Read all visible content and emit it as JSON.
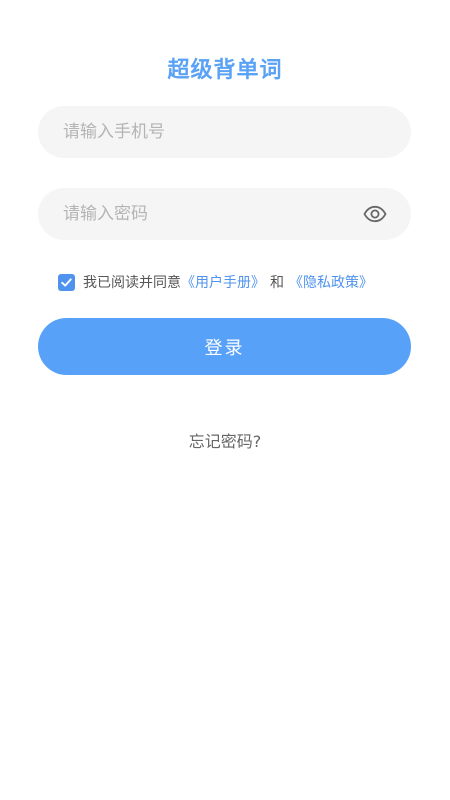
{
  "app": {
    "title": "超级背单词"
  },
  "form": {
    "phone_placeholder": "请输入手机号",
    "phone_value": "",
    "password_placeholder": "请输入密码",
    "password_value": "",
    "password_toggle_icon": "eye-icon"
  },
  "agreement": {
    "checked": true,
    "prefix": "我已阅读并同意",
    "user_manual": "《用户手册》",
    "connector": "和",
    "privacy_policy": "《隐私政策》"
  },
  "actions": {
    "login_label": "登录",
    "forgot_label": "忘记密码?"
  },
  "colors": {
    "accent": "#58a1f8",
    "input_bg": "#f5f5f5",
    "placeholder": "#b4b4b4"
  }
}
